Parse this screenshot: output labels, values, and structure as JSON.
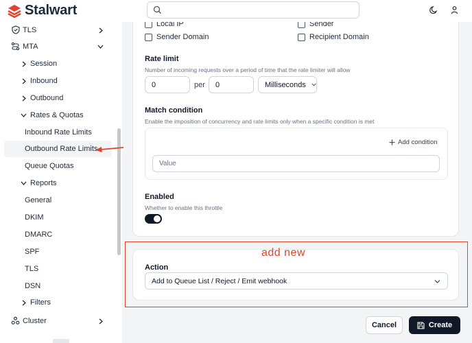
{
  "header": {
    "brand": "Stalwart",
    "search": {
      "value": "",
      "placeholder": ""
    },
    "icons": [
      "moon-icon",
      "user-icon"
    ]
  },
  "sidebar": {
    "items": [
      {
        "label": "TLS",
        "icon": "shield-icon",
        "expanded": false
      },
      {
        "label": "MTA",
        "icon": "routes-icon",
        "expanded": true
      },
      {
        "label": "Session",
        "expanded": false
      },
      {
        "label": "Inbound",
        "expanded": false
      },
      {
        "label": "Outbound",
        "expanded": false
      },
      {
        "label": "Rates & Quotas",
        "expanded": true
      },
      {
        "label": "Inbound Rate Limits"
      },
      {
        "label": "Outbound Rate Limits",
        "active": true
      },
      {
        "label": "Queue Quotas"
      },
      {
        "label": "Reports",
        "expanded": true
      },
      {
        "label": "General"
      },
      {
        "label": "DKIM"
      },
      {
        "label": "DMARC"
      },
      {
        "label": "SPF"
      },
      {
        "label": "TLS"
      },
      {
        "label": "DSN"
      },
      {
        "label": "Filters",
        "expanded": false
      },
      {
        "label": "Cluster",
        "icon": "cluster-icon",
        "expanded": false
      }
    ]
  },
  "form": {
    "keys": [
      {
        "label": "Local IP",
        "checked": false
      },
      {
        "label": "Sender",
        "checked": false
      },
      {
        "label": "Sender Domain",
        "checked": false
      },
      {
        "label": "Recipient Domain",
        "checked": false
      }
    ],
    "rate_limit": {
      "label": "Rate limit",
      "help": "Number of incoming requests over a period of time that the rate limiter will allow",
      "count": "0",
      "per_label": "per",
      "period": "0",
      "unit": "Milliseconds"
    },
    "match_condition": {
      "label": "Match condition",
      "help": "Enable the imposition of concurrency and rate limits only when a specific condition is met",
      "add_label": "Add condition",
      "value_placeholder": "Value"
    },
    "enabled": {
      "label": "Enabled",
      "help": "Whether to enable this throttle",
      "on": true
    },
    "action": {
      "label": "Action",
      "value": "Add to Queue List / Reject / Emit webhook"
    }
  },
  "annotation": {
    "text": "add new",
    "color": "#e0442b"
  },
  "footer": {
    "cancel_label": "Cancel",
    "create_label": "Create"
  },
  "colors": {
    "accent": "#111827",
    "brand": "#e0442b",
    "annotation": "#e0442b"
  }
}
